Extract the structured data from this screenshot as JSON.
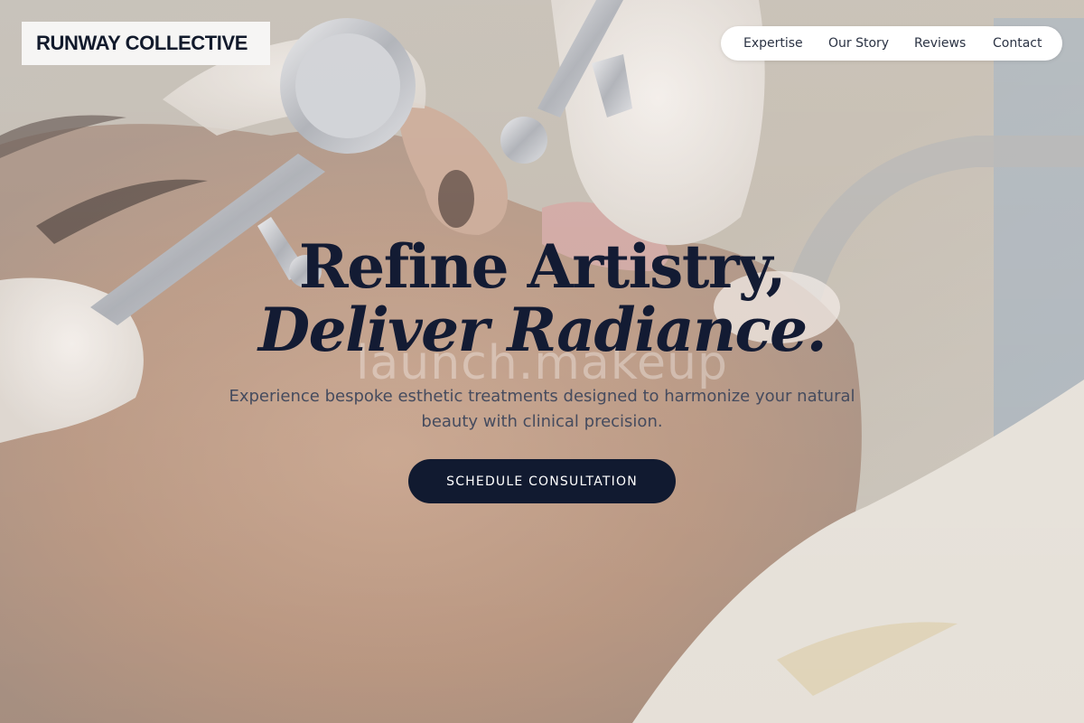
{
  "brand": {
    "name": "RUNWAY COLLECTIVE"
  },
  "nav": {
    "items": [
      {
        "label": "Expertise"
      },
      {
        "label": "Our Story"
      },
      {
        "label": "Reviews"
      },
      {
        "label": "Contact"
      }
    ]
  },
  "hero": {
    "headline_line1": "Refine Artistry,",
    "headline_line2": "Deliver Radiance.",
    "watermark": "launch.makeup",
    "subheading": "Experience bespoke esthetic treatments designed to harmonize your natural beauty with clinical precision.",
    "cta_label": "SCHEDULE CONSULTATION"
  },
  "colors": {
    "headline": "#131b33",
    "cta_background": "#111a30",
    "cta_text": "#ffffff",
    "nav_background": "#ffffff",
    "brand_background": "#f6f5f4"
  },
  "images": {
    "hero_background": "facial-treatment-photo"
  }
}
